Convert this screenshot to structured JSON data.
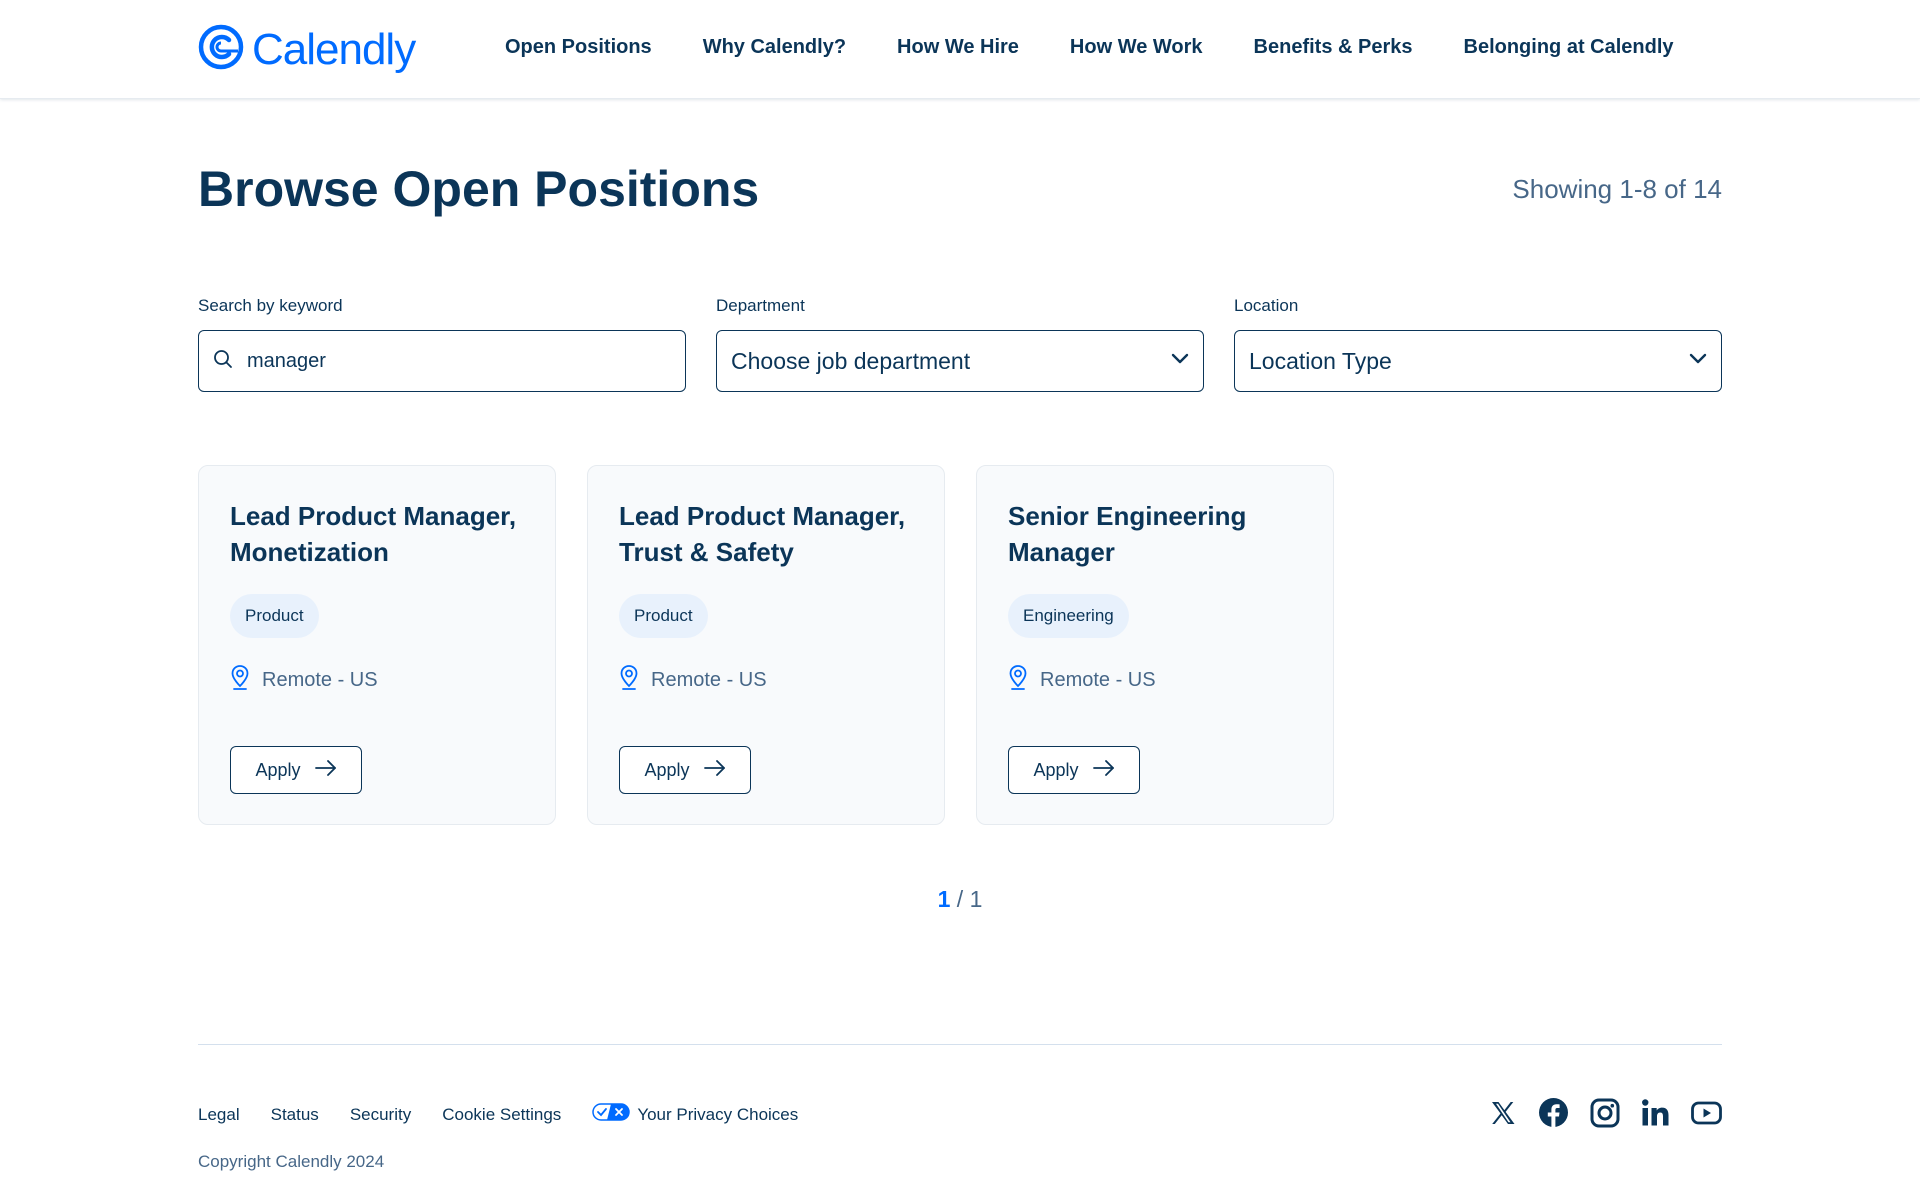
{
  "header": {
    "logo_text": "Calendly",
    "nav": [
      {
        "label": "Open Positions"
      },
      {
        "label": "Why Calendly?"
      },
      {
        "label": "How We Hire"
      },
      {
        "label": "How We Work"
      },
      {
        "label": "Benefits & Perks"
      },
      {
        "label": "Belonging at Calendly"
      }
    ]
  },
  "main": {
    "title": "Browse Open Positions",
    "showing": "Showing 1-8 of 14"
  },
  "filters": {
    "search": {
      "label": "Search by keyword",
      "value": "manager"
    },
    "department": {
      "label": "Department",
      "selected": "Choose job department"
    },
    "location": {
      "label": "Location",
      "selected": "Location Type"
    }
  },
  "jobs": [
    {
      "title": "Lead Product Manager, Monetization",
      "department": "Product",
      "location": "Remote - US",
      "apply_label": "Apply"
    },
    {
      "title": "Lead Product Manager, Trust & Safety",
      "department": "Product",
      "location": "Remote - US",
      "apply_label": "Apply"
    },
    {
      "title": "Senior Engineering Manager",
      "department": "Engineering",
      "location": "Remote - US",
      "apply_label": "Apply"
    }
  ],
  "pagination": {
    "current": "1",
    "separator": "/",
    "total": "1"
  },
  "footer": {
    "links": [
      {
        "label": "Legal"
      },
      {
        "label": "Status"
      },
      {
        "label": "Security"
      },
      {
        "label": "Cookie Settings"
      },
      {
        "label": "Your Privacy Choices"
      }
    ],
    "copyright": "Copyright Calendly 2024",
    "social": [
      "x-icon",
      "facebook-icon",
      "instagram-icon",
      "linkedin-icon",
      "youtube-icon"
    ]
  },
  "colors": {
    "brand": "#006bff",
    "text": "#0b3558",
    "muted": "#476788",
    "tag_bg": "#e8f1fc"
  }
}
